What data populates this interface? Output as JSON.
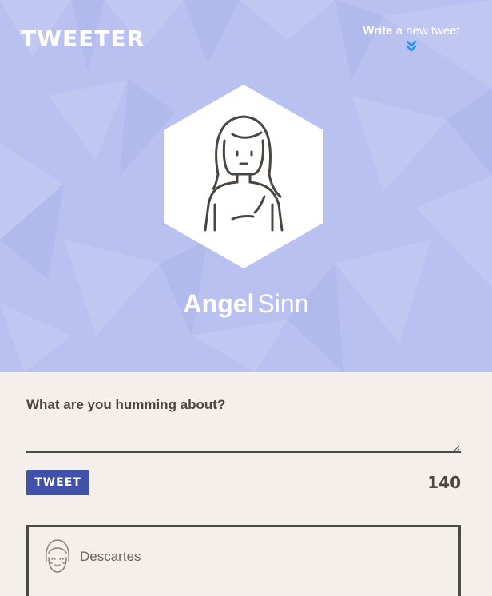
{
  "header": {
    "brand": "TWEETER",
    "compose_link_bold": "Write",
    "compose_link_rest": "a new tweet",
    "accent": "#1e90ff",
    "background": "#b8c1ef"
  },
  "profile": {
    "first_name": "Angel",
    "last_name": "Sinn",
    "avatar_icon": "woman-avatar-icon"
  },
  "compose": {
    "label": "What are you humming about?",
    "text_value": "",
    "button_label": "TWEET",
    "counter": "140",
    "button_color": "#3f51a8"
  },
  "tweets": [
    {
      "author": "Descartes",
      "avatar_icon": "girl-avatar-icon"
    }
  ]
}
